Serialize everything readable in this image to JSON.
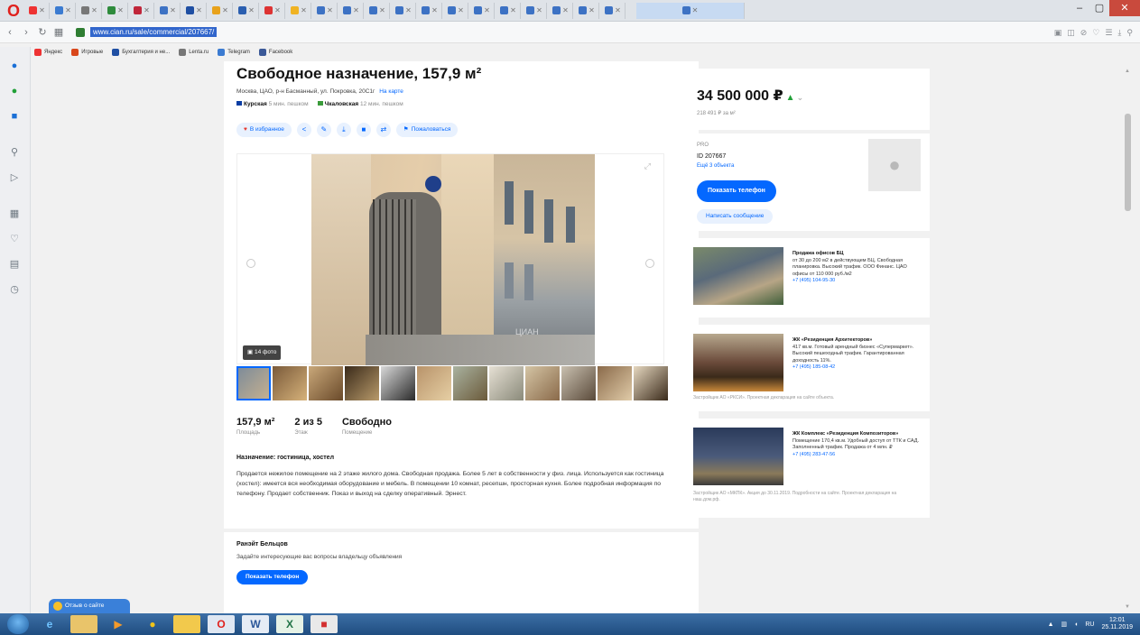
{
  "browser": {
    "address_url": "www.cian.ru/sale/commercial/207667/",
    "bookmarks": [
      {
        "label": "Яндекс",
        "color": "#e33"
      },
      {
        "label": "Игровые",
        "color": "#d9471b"
      },
      {
        "label": "Бухгалтерия и не...",
        "color": "#1f4fa3"
      },
      {
        "label": "Lenta.ru",
        "color": "#777777"
      },
      {
        "label": "Telegram",
        "color": "#3b7bd1"
      },
      {
        "label": "Facebook",
        "color": "#3b5998"
      }
    ]
  },
  "listing": {
    "title": "Свободное назначение, 157,9 м²",
    "address": "Москва, ЦАО, р-н Басманный, ул. Покровка, 20С1г",
    "map_link": "На карте",
    "metros": [
      {
        "name": "Курская",
        "time": "5 мин. пешком",
        "line_color": "#0a3da3"
      },
      {
        "name": "Чкаловская",
        "time": "12 мин. пешком",
        "line_color": "#3a9b3a"
      }
    ],
    "favorite_label": "В избранное",
    "complain_label": "Пожаловаться",
    "photo_count": "14 фото",
    "watermark": "ЦИАН",
    "stats": [
      {
        "value": "157,9 м²",
        "label": "Площадь"
      },
      {
        "value": "2 из 5",
        "label": "Этаж"
      },
      {
        "value": "Свободно",
        "label": "Помещение"
      }
    ],
    "purpose": "Назначение: гостиница, хостел",
    "description": "Продается нежилое помещение на 2 этаже жилого дома. Свободная продажа. Более 5 лет в собственности у физ. лица. Используется как гостиница (хостел): имеется вся необходимая оборудование и мебель. В помещении 10 комнат, ресепшн, просторная кухня. Более подробная информация по телефону. Продает собственник. Показ и выход на сделку оперативный. Эрнест."
  },
  "contact": {
    "name": "Ранэйт Бельцов",
    "subtitle": "Задайте интересующие вас вопросы владельцу объявления",
    "button": "Показать телефон"
  },
  "price": {
    "value": "34 500 000 ₽",
    "per_m2": "218 491 ₽ за м²"
  },
  "seller": {
    "type": "PRO",
    "id": "ID 207667",
    "link": "Ещё 3 объекта",
    "phone_button": "Показать телефон",
    "message_button": "Написать сообщение"
  },
  "ads": [
    {
      "title": "Продажа офисов БЦ",
      "text": "от 30 до 200 м2 в действующем БЦ. Свободная планировка. Высокий трафик. ООО Финанс. ЦАО офисы от 110 000 руб./м2",
      "phone": "+7 (495) 104-95-30",
      "footer": ""
    },
    {
      "title": "ЖК «Резиденция Архитекторов»",
      "text": "417 кв.м. Готовый арендный бизнес «Супермаркет». Высокий пешеходный трафик. Гарантированная доходность 11%.",
      "phone": "+7 (495) 185-08-42",
      "footer": "Застройщик АО «РКСИ». Проектная декларация на сайте объекта."
    },
    {
      "title": "ЖК Комплекс «Резиденция Композиторов»",
      "text": "Помещение 170,4 кв.м. Удобный доступ от ТТК и САД. Заполненный трафик. Продажа от 4 млн. ₽",
      "phone": "+7 (495) 283-47-56",
      "footer": "Застройщик АО «МКПК». Акция до 30.11.2019. Подробности на сайте. Проектная декларация на наш.дом.рф."
    }
  ],
  "notification": "Отзыв о сайте",
  "taskbar": {
    "time": "12:01",
    "date": "25.11.2019"
  }
}
